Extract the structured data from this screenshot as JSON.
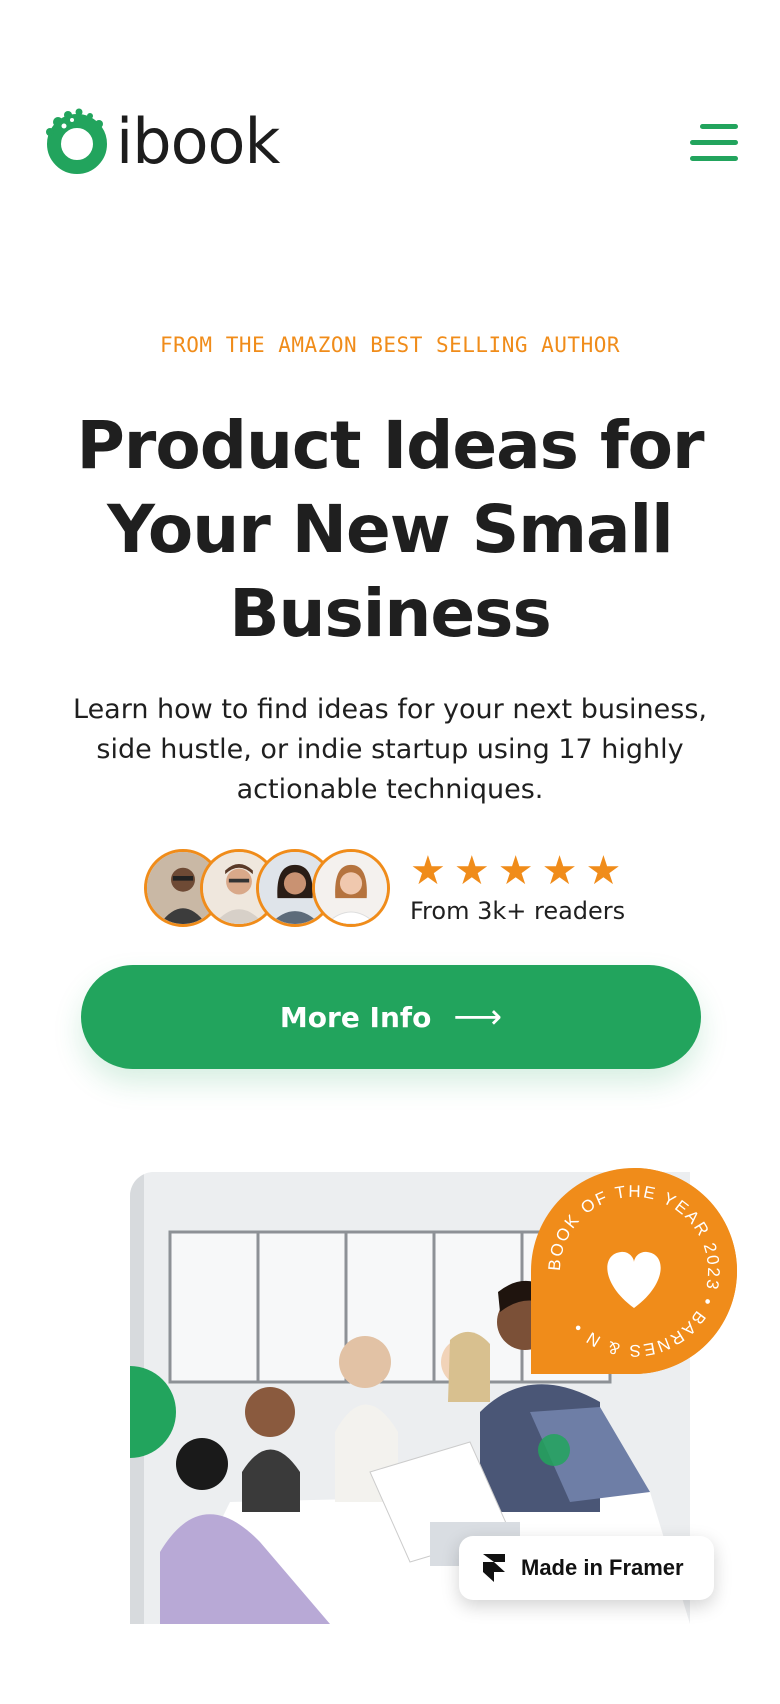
{
  "header": {
    "brand": "ibook",
    "logo_icon": "ibook-leaf-ring-logo",
    "menu_icon": "hamburger-menu-icon"
  },
  "hero": {
    "eyebrow": "FROM THE AMAZON BEST SELLING AUTHOR",
    "title": "Product Ideas for Your New Small Business",
    "description": "Learn how to find ideas for your next business, side hustle, or indie startup using 17 highly actionable techniques.",
    "rating": {
      "stars": 5,
      "caption": "From 3k+ readers"
    },
    "cta": {
      "label": "More Info",
      "icon": "arrow-right-icon"
    }
  },
  "badge": {
    "text": "BOOK OF THE YEAR 2023 • BARNES & N •",
    "icon": "heart-icon"
  },
  "framer_badge": {
    "label": "Made in Framer",
    "icon": "framer-logo-icon"
  },
  "colors": {
    "brand_green": "#22a45d",
    "accent_orange": "#f08c1a",
    "text_dark": "#1f1f1f"
  }
}
